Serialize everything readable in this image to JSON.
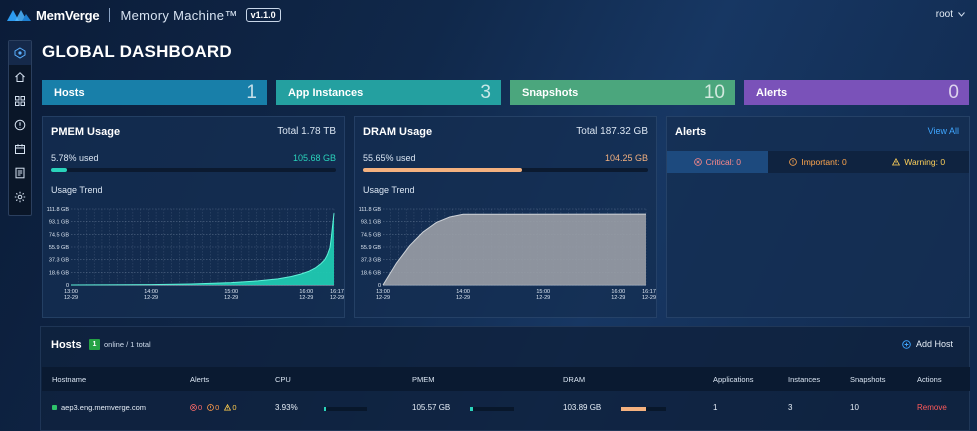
{
  "header": {
    "brand": "MemVerge",
    "product": "Memory Machine™",
    "version": "v1.1.0",
    "user": "root"
  },
  "colors": {
    "hosts_card": "#187fa9",
    "instances_card": "#24a0a0",
    "snapshots_card": "#4ba67d",
    "alerts_card": "#7a52b9",
    "pmem_accent": "#2ad3bb",
    "dram_accent": "#f4b17f"
  },
  "page": {
    "title": "GLOBAL DASHBOARD"
  },
  "stats": [
    {
      "label": "Hosts",
      "value": "1"
    },
    {
      "label": "App Instances",
      "value": "3"
    },
    {
      "label": "Snapshots",
      "value": "10"
    },
    {
      "label": "Alerts",
      "value": "0"
    }
  ],
  "pmem": {
    "title": "PMEM Usage",
    "total": "Total 1.78 TB",
    "used_pct": "5.78% used",
    "used_val": "105.68 GB",
    "fraction": 0.0578,
    "trend_title": "Usage Trend"
  },
  "dram": {
    "title": "DRAM Usage",
    "total": "Total 187.32 GB",
    "used_pct": "55.65% used",
    "used_val": "104.25 GB",
    "fraction": 0.5565,
    "trend_title": "Usage Trend"
  },
  "chart_data": [
    {
      "type": "area",
      "title": "Usage Trend",
      "y_ticks": [
        "0",
        "18.6 GB",
        "37.3 GB",
        "55.9 GB",
        "74.5 GB",
        "93.1 GB",
        "111.8 GB"
      ],
      "ylim": [
        0,
        111.8
      ],
      "x_ticks": [
        {
          "time": "13:00",
          "date": "12-29"
        },
        {
          "time": "14:00",
          "date": "12-29"
        },
        {
          "time": "15:00",
          "date": "12-29"
        },
        {
          "time": "16:00",
          "date": "12-29"
        },
        {
          "time": "16:17",
          "date": "12-29"
        }
      ],
      "x_minutes": [
        0,
        60,
        120,
        180,
        197
      ],
      "x": [
        0,
        60,
        90,
        120,
        140,
        155,
        165,
        172,
        178,
        183,
        187,
        190,
        192,
        194,
        195,
        196,
        197
      ],
      "y": [
        0,
        0.6,
        1.5,
        3.5,
        6,
        9,
        12.5,
        16,
        20,
        25,
        31,
        37,
        44,
        55,
        70,
        88,
        105.7
      ],
      "grid": true
    },
    {
      "type": "area",
      "title": "Usage Trend",
      "y_ticks": [
        "0",
        "18.6 GB",
        "37.3 GB",
        "55.9 GB",
        "74.5 GB",
        "93.1 GB",
        "111.8 GB"
      ],
      "ylim": [
        0,
        111.8
      ],
      "x_ticks": [
        {
          "time": "13:00",
          "date": "12-29"
        },
        {
          "time": "14:00",
          "date": "12-29"
        },
        {
          "time": "15:00",
          "date": "12-29"
        },
        {
          "time": "16:00",
          "date": "12-29"
        },
        {
          "time": "16:17",
          "date": "12-29"
        }
      ],
      "x_minutes": [
        0,
        60,
        120,
        180,
        197
      ],
      "x": [
        0,
        10,
        20,
        30,
        40,
        50,
        60,
        197
      ],
      "y": [
        0,
        32,
        58,
        78,
        92,
        100,
        104,
        104.25
      ],
      "grid": true
    }
  ],
  "alerts_panel": {
    "title": "Alerts",
    "view_all": "View All",
    "critical": "Critical: 0",
    "important": "Important: 0",
    "warning": "Warning: 0"
  },
  "hosts": {
    "title": "Hosts",
    "online_count": "1",
    "online_text": "online / 1 total",
    "add_host": "Add Host",
    "columns": [
      "Hostname",
      "Alerts",
      "CPU",
      "PMEM",
      "DRAM",
      "Applications",
      "Instances",
      "Snapshots",
      "Actions"
    ],
    "rows": [
      {
        "hostname": "aep3.eng.memverge.com",
        "alerts_critical": "0",
        "alerts_important": "0",
        "alerts_warning": "0",
        "cpu": "3.93%",
        "cpu_fraction": 0.0393,
        "pmem": "105.57 GB",
        "pmem_fraction": 0.0578,
        "dram": "103.89 GB",
        "dram_fraction": 0.5545,
        "applications": "1",
        "instances": "3",
        "snapshots": "10",
        "action": "Remove"
      }
    ]
  }
}
